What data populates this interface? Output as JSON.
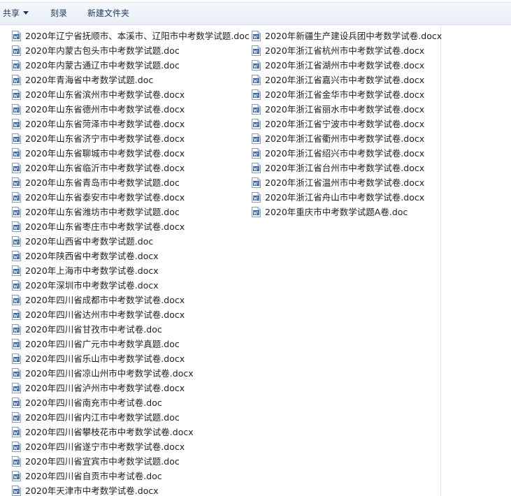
{
  "toolbar": {
    "share_label": "共享",
    "burn_label": "刻录",
    "new_folder_label": "新建文件夹"
  },
  "files_col1": [
    "2020年辽宁省抚顺市、本溪市、辽阳市中考数学试题.doc",
    "2020年内蒙古包头市中考数学试题.doc",
    "2020年内蒙古通辽市中考数学试题.doc",
    "2020年青海省中考数学试题.doc",
    "2020年山东省滨州市中考数学试卷.docx",
    "2020年山东省德州市中考数学试卷.docx",
    "2020年山东省菏泽市中考数学试卷.docx",
    "2020年山东省济宁市中考数学试卷.docx",
    "2020年山东省聊城市中考数学试卷.docx",
    "2020年山东省临沂市中考数学试卷.docx",
    "2020年山东省青岛市中考数学试题.doc",
    "2020年山东省泰安市中考数学试卷.docx",
    "2020年山东省潍坊市中考数学试题.doc",
    "2020年山东省枣庄市中考数学试卷.docx",
    "2020年山西省中考数学试题.doc",
    "2020年陕西省中考数学试卷.docx",
    "2020年上海市中考数学试卷.docx",
    "2020年深圳市中考数学试卷.docx",
    "2020年四川省成都市中考数学试卷.docx",
    "2020年四川省达州市中考数学试卷.docx",
    "2020年四川省甘孜市中考试卷.doc",
    "2020年四川省广元市中考数学真题.doc",
    "2020年四川省乐山市中考数学试卷.docx",
    "2020年四川省凉山州市中考数学试卷.docx",
    "2020年四川省泸州市中考数学试卷.docx",
    "2020年四川省南充市中考试卷.doc",
    "2020年四川省内江市中考数学试题.doc",
    "2020年四川省攀枝花市中考数学试卷.docx",
    "2020年四川省遂宁市中考数学试卷.docx",
    "2020年四川省宜宾市中考数学试题.doc",
    "2020年四川省自贡市中考试卷.doc",
    "2020年天津市中考数学试卷.docx"
  ],
  "files_col2": [
    "2020年新疆生产建设兵团中考数学试卷.docx",
    "2020年浙江省杭州市中考数学试卷.docx",
    "2020年浙江省湖州市中考数学试卷.docx",
    "2020年浙江省嘉兴市中考数学试卷.docx",
    "2020年浙江省金华市中考数学试卷.docx",
    "2020年浙江省丽水市中考数学试卷.docx",
    "2020年浙江省宁波市中考数学试卷.docx",
    "2020年浙江省衢州市中考数学试卷.docx",
    "2020年浙江省绍兴市中考数学试卷.docx",
    "2020年浙江省台州市中考数学试卷.docx",
    "2020年浙江省温州市中考数学试卷.docx",
    "2020年浙江省舟山市中考数学试卷.docx",
    "2020年重庆市中考数学试题A卷.doc"
  ],
  "icons": {
    "file_icon": "word-document-icon",
    "accent": "#2b579a"
  }
}
